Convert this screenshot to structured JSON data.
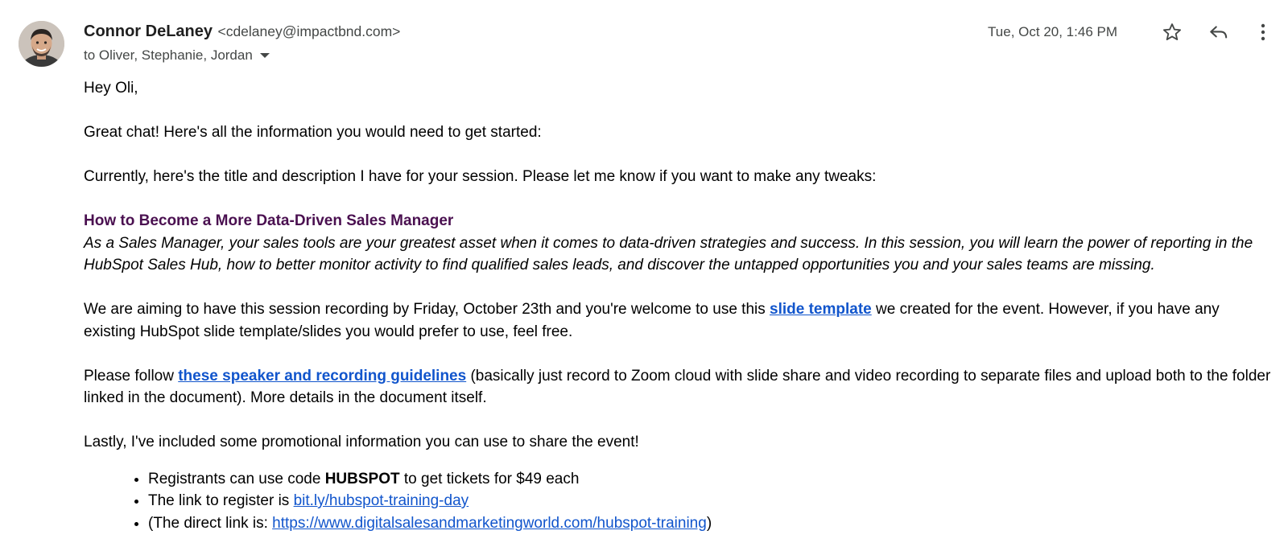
{
  "header": {
    "sender_name": "Connor DeLaney",
    "sender_email": "<cdelaney@impactbnd.com>",
    "recipients": "to Oliver, Stephanie, Jordan",
    "date": "Tue, Oct 20, 1:46 PM",
    "icons": {
      "avatar": "sender-avatar",
      "star": "star-icon",
      "reply": "reply-icon",
      "more": "more-vert-icon",
      "recipients_toggle": "caret-down-icon"
    }
  },
  "body": {
    "greeting": "Hey Oli,",
    "intro": "Great chat! Here's all the information you would need to get started:",
    "current": "Currently, here's the title and description I have for your session. Please let me know if you want to make any tweaks:",
    "session_title": "How to Become a More Data-Driven Sales Manager",
    "session_description": "As a Sales Manager, your sales tools are your greatest asset when it comes to data-driven strategies and success. In this session, you will learn the power of reporting in the HubSpot Sales Hub, how to better monitor activity to find qualified sales leads, and discover the untapped opportunities you and your sales teams are missing.",
    "recording_pre": "We are aiming to have this session recording by Friday, October 23th and you're welcome to use this ",
    "recording_link": "slide template",
    "recording_post": " we created for the event. However, if you have any existing HubSpot slide template/slides you would prefer to use, feel free.",
    "follow_pre": "Please follow ",
    "follow_link": "these speaker and recording guidelines",
    "follow_post": " (basically just record to Zoom cloud with slide share and video recording to separate files and upload both to the folder linked in the document). More details in the document itself.",
    "lastly": "Lastly, I've included some promotional information you can use to share the event!",
    "promo": {
      "item1_pre": "Registrants can use code ",
      "item1_code": "HUBSPOT",
      "item1_post": " to get tickets for $49 each",
      "item2_pre": "The link to register is ",
      "item2_link": "bit.ly/hubspot-training-day",
      "item3_pre": "(The direct link is: ",
      "item3_link": "https://www.digitalsalesandmarketingworld.com/hubspot-training",
      "item3_post": ")"
    }
  },
  "colors": {
    "link": "#1155cc",
    "session_title": "#4a1050",
    "meta_text": "#444746"
  }
}
